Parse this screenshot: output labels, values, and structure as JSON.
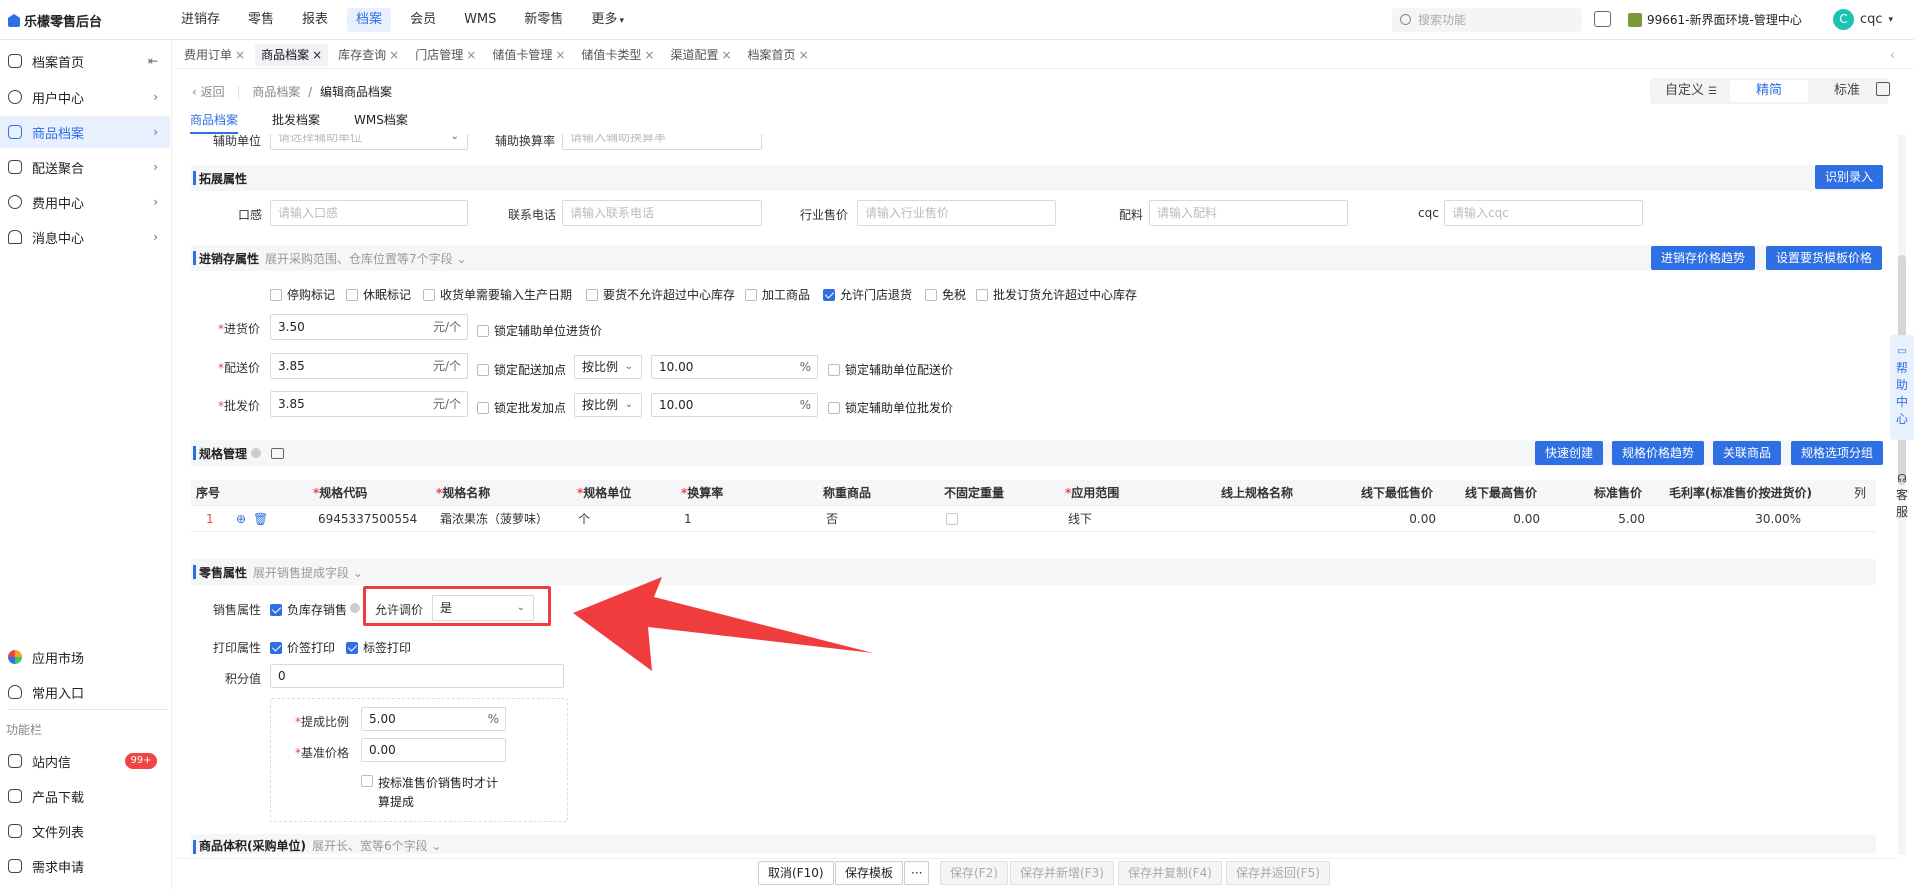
{
  "app": {
    "title": "乐檬零售后台"
  },
  "topnav": [
    "进销存",
    "零售",
    "报表",
    "档案",
    "会员",
    "WMS",
    "新零售",
    "更多"
  ],
  "topnav_active": 3,
  "search_placeholder": "搜索功能",
  "store_name": "99661-新界面环境-管理中心",
  "user": {
    "initial": "C",
    "name": "cqc"
  },
  "sidebar": {
    "items": [
      {
        "label": "档案首页",
        "icon": "home-icon",
        "arrow": "⇤"
      },
      {
        "label": "用户中心",
        "icon": "user-icon",
        "arrow": "›"
      },
      {
        "label": "商品档案",
        "icon": "goods-icon",
        "arrow": "›"
      },
      {
        "label": "配送聚合",
        "icon": "delivery-icon",
        "arrow": "›"
      },
      {
        "label": "费用中心",
        "icon": "money-icon",
        "arrow": "›"
      },
      {
        "label": "消息中心",
        "icon": "bell-icon",
        "arrow": "›"
      }
    ],
    "bottom_items": [
      {
        "label": "应用市场",
        "icon": "apps-icon"
      },
      {
        "label": "常用入口",
        "icon": "heart-icon"
      }
    ],
    "section_label": "功能栏",
    "tools": [
      {
        "label": "站内信",
        "icon": "mail-icon",
        "badge": "99+"
      },
      {
        "label": "产品下载",
        "icon": "download-icon",
        "badge": ""
      },
      {
        "label": "文件列表",
        "icon": "list-icon",
        "badge": ""
      },
      {
        "label": "需求申请",
        "icon": "request-icon",
        "badge": ""
      }
    ]
  },
  "tabs": [
    "费用订单",
    "商品档案",
    "库存查询",
    "门店管理",
    "储值卡管理",
    "储值卡类型",
    "渠道配置",
    "档案首页"
  ],
  "tab_active": 1,
  "breadcrumb": {
    "back": "‹ 返回",
    "parent": "商品档案",
    "sep": "/",
    "current": "编辑商品档案"
  },
  "modes": [
    "自定义",
    "精简",
    "标准"
  ],
  "mode_active": 1,
  "subtabs": [
    "商品档案",
    "批发档案",
    "WMS档案"
  ],
  "subtab_active": 0,
  "aux_unit": {
    "label": "辅助单位",
    "placeholder": "请选择辅助单位",
    "rate_label": "辅助换算率",
    "rate_placeholder": "请输入辅助换算率"
  },
  "ext": {
    "title": "拓展属性",
    "button": "识别录入",
    "fields": [
      {
        "label": "口感",
        "placeholder": "请输入口感"
      },
      {
        "label": "联系电话",
        "placeholder": "请输入联系电话"
      },
      {
        "label": "行业售价",
        "placeholder": "请输入行业售价"
      },
      {
        "label": "配料",
        "placeholder": "请输入配料"
      },
      {
        "label": "cqc",
        "placeholder": "请输入cqc"
      }
    ]
  },
  "inv": {
    "title": "进销存属性",
    "hint": "展开采购范围、仓库位置等7个字段 ⌄",
    "btn_trend": "进销存价格趋势",
    "btn_template": "设置要货模板价格",
    "checks": [
      {
        "label": "停购标记",
        "on": false
      },
      {
        "label": "休眠标记",
        "on": false
      },
      {
        "label": "收货单需要输入生产日期",
        "on": false
      },
      {
        "label": "要货不允许超过中心库存",
        "on": false
      },
      {
        "label": "加工商品",
        "on": false
      },
      {
        "label": "允许门店退货",
        "on": true
      },
      {
        "label": "免税",
        "on": false
      },
      {
        "label": "批发订货允许超过中心库存",
        "on": false
      }
    ],
    "purchase": {
      "label": "进货价",
      "value": "3.50",
      "unit": "元/个",
      "lock": "锁定辅助单位进货价"
    },
    "delivery": {
      "label": "配送价",
      "value": "3.85",
      "unit": "元/个",
      "markup": "锁定配送加点",
      "mode": "按比例",
      "ratio": "10.00",
      "pct": "%",
      "lock": "锁定辅助单位配送价"
    },
    "wholesale": {
      "label": "批发价",
      "value": "3.85",
      "unit": "元/个",
      "markup": "锁定批发加点",
      "mode": "按比例",
      "ratio": "10.00",
      "pct": "%",
      "lock": "锁定辅助单位批发价"
    }
  },
  "spec": {
    "title": "规格管理",
    "buttons": [
      "快速创建",
      "规格价格趋势",
      "关联商品",
      "规格选项分组"
    ],
    "columns": [
      "序号",
      "*规格代码",
      "*规格名称",
      "*规格单位",
      "*换算率",
      "称重商品",
      "不固定重量",
      "*应用范围",
      "线上规格名称",
      "线下最低售价",
      "线下最高售价",
      "标准售价",
      "毛利率(标准售价按进货价)"
    ],
    "col_btn": "列",
    "rows": [
      {
        "no": "1",
        "code": "6945337500554",
        "name": "霜浓果冻（菠萝味）",
        "unit": "个",
        "rate": "1",
        "weigh": "否",
        "scope": "线下",
        "online": "",
        "min": "0.00",
        "max": "0.00",
        "std": "5.00",
        "margin": "30.00%"
      }
    ]
  },
  "retail": {
    "title": "零售属性",
    "hint": "展开销售提成字段 ⌄",
    "sale_label": "销售属性",
    "neg_stock": "负库存销售",
    "allow_adjust": "允许调价",
    "allow_adjust_value": "是",
    "print_label": "打印属性",
    "price_print": "价签打印",
    "tag_print": "标签打印",
    "points_label": "积分值",
    "points_value": "0",
    "commission_label": "提成比例",
    "commission_value": "5.00",
    "commission_pct": "%",
    "base_label": "基准价格",
    "base_value": "0.00",
    "std_calc_1": "按标准售价销售时才计",
    "std_calc_2": "算提成"
  },
  "volume": {
    "title": "商品体积(采购单位)",
    "hint": "展开长、宽等6个字段 ⌄"
  },
  "footer": {
    "cancel": "取消(F10)",
    "save_template": "保存模板",
    "more": "···",
    "save": "保存(F2)",
    "save_new": "保存并新增(F3)",
    "save_copy": "保存并复制(F4)",
    "save_back": "保存并返回(F5)"
  },
  "help": {
    "chars": [
      "帮",
      "助",
      "中",
      "心"
    ]
  },
  "kefu": {
    "chars": [
      "客",
      "服"
    ]
  },
  "colors": {
    "primary": "#2f6fe4",
    "highlight": "#f03c3c"
  }
}
